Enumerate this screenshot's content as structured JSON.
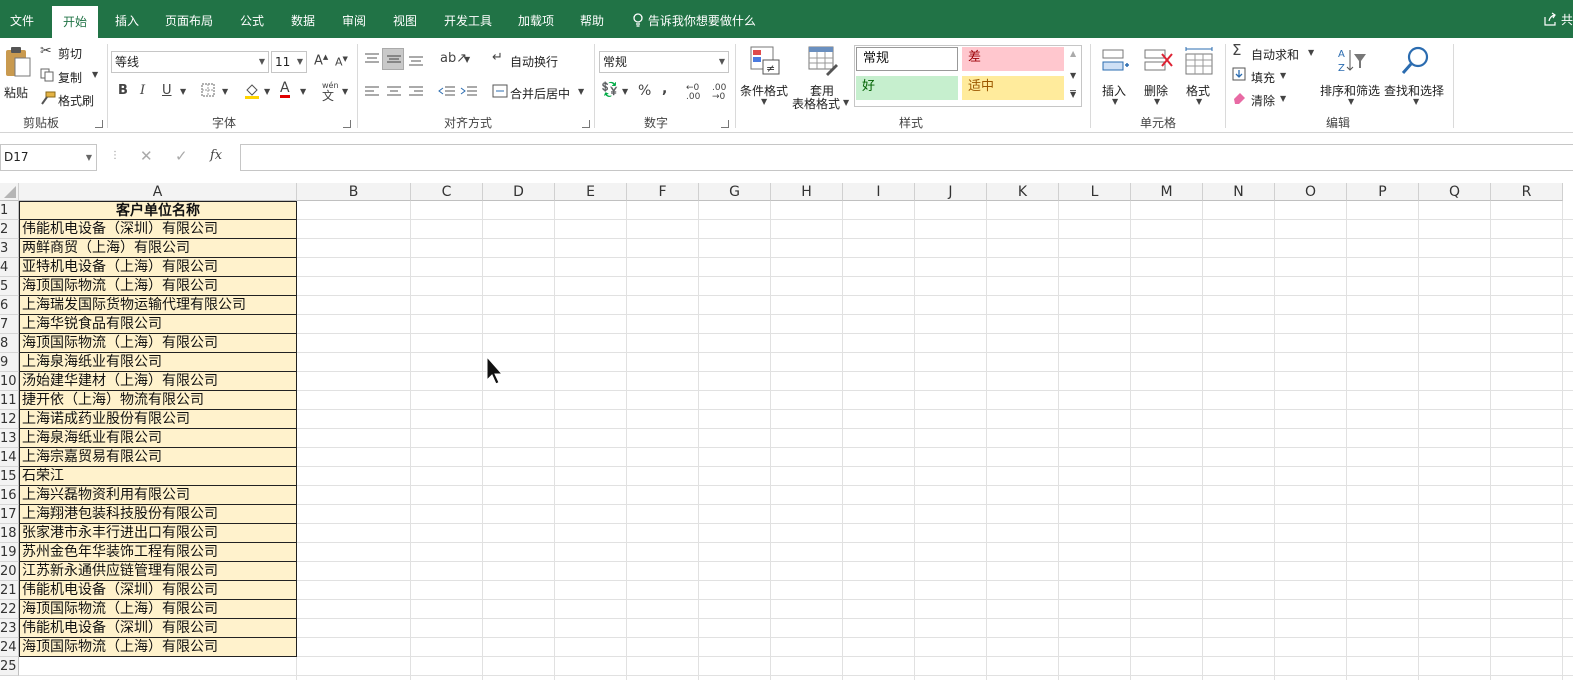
{
  "tabs": [
    "文件",
    "开始",
    "插入",
    "页面布局",
    "公式",
    "数据",
    "审阅",
    "视图",
    "开发工具",
    "加载项",
    "帮助"
  ],
  "active_tab": "开始",
  "tell_me": "告诉我你想要做什么",
  "share": "共",
  "clipboard": {
    "paste": "粘贴",
    "cut": "剪切",
    "copy": "复制",
    "format_painter": "格式刷",
    "label": "剪贴板"
  },
  "font": {
    "name": "等线",
    "size": "11",
    "bold": "B",
    "italic": "I",
    "underline": "U",
    "label": "字体",
    "phonetic": "wén"
  },
  "alignment": {
    "wrap": "自动换行",
    "merge": "合并后居中",
    "label": "对齐方式"
  },
  "number": {
    "format": "常规",
    "percent": "%",
    "comma": ",",
    "label": "数字"
  },
  "styles": {
    "conditional": "条件格式",
    "table_line1": "套用",
    "table_line2": "表格格式",
    "cells": [
      {
        "text": "常规",
        "bg": "#ffffff",
        "fg": "#111111"
      },
      {
        "text": "差",
        "bg": "#ffc7ce",
        "fg": "#9c0006"
      },
      {
        "text": "好",
        "bg": "#c6efce",
        "fg": "#006100"
      },
      {
        "text": "适中",
        "bg": "#ffeb9c",
        "fg": "#9c5700"
      }
    ],
    "label": "样式"
  },
  "cells_group": {
    "insert": "插入",
    "delete": "删除",
    "format": "格式",
    "label": "单元格"
  },
  "editing": {
    "autosum": "自动求和",
    "fill": "填充",
    "clear": "清除",
    "sort": "排序和筛选",
    "find": "查找和选择",
    "label": "编辑"
  },
  "formula_bar": {
    "name_box": "D17",
    "formula": ""
  },
  "columns": [
    "A",
    "B",
    "C",
    "D",
    "E",
    "F",
    "G",
    "H",
    "I",
    "J",
    "K",
    "L",
    "M",
    "N",
    "O",
    "P",
    "Q",
    "R"
  ],
  "rows": [
    "1",
    "2",
    "3",
    "4",
    "5",
    "6",
    "7",
    "8",
    "9",
    "10",
    "11",
    "12",
    "13",
    "14",
    "15",
    "16",
    "17",
    "18",
    "19",
    "20",
    "21",
    "22",
    "23",
    "24",
    "25"
  ],
  "column_a": [
    "客户单位名称",
    "伟能机电设备（深圳）有限公司",
    "两鲜商贸（上海）有限公司",
    "亚特机电设备（上海）有限公司",
    "海顶国际物流（上海）有限公司",
    "上海瑞发国际货物运输代理有限公司",
    "上海华锐食品有限公司",
    "海顶国际物流（上海）有限公司",
    "上海泉海纸业有限公司",
    "汤始建华建材（上海）有限公司",
    "捷开依（上海）物流有限公司",
    "上海诺成药业股份有限公司",
    "上海泉海纸业有限公司",
    "上海宗嘉贸易有限公司",
    "石荣江",
    "上海兴磊物资利用有限公司",
    "上海翔港包装科技股份有限公司",
    "张家港市永丰行进出口有限公司",
    "苏州金色年华装饰工程有限公司",
    "江苏新永通供应链管理有限公司",
    "伟能机电设备（深圳）有限公司",
    "海顶国际物流（上海）有限公司",
    "伟能机电设备（深圳）有限公司",
    "海顶国际物流（上海）有限公司"
  ],
  "colors": {
    "brand": "#217346",
    "table_fill": "#fff2cc"
  }
}
